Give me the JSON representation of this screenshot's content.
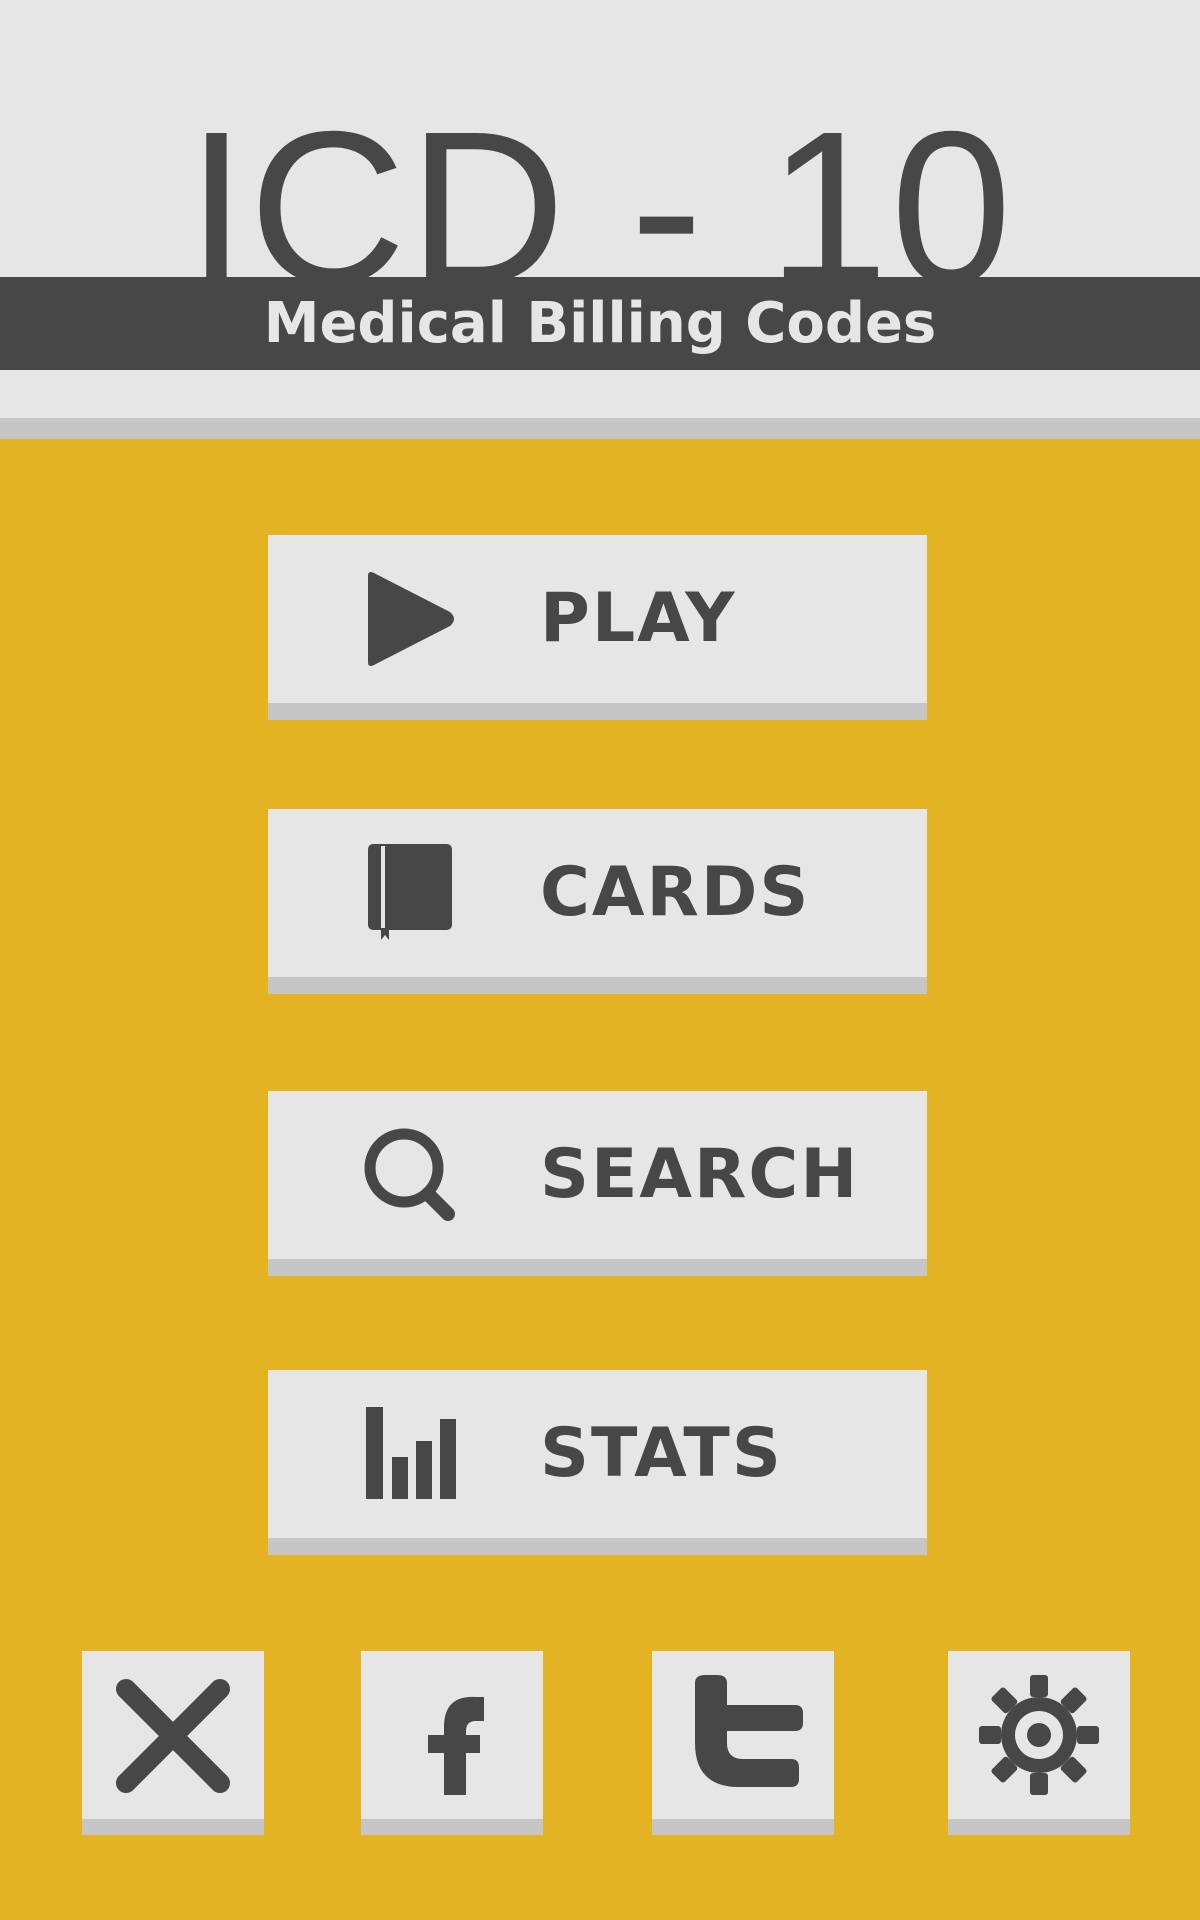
{
  "header": {
    "title": "ICD - 10",
    "subtitle": "Medical Billing Codes"
  },
  "menu": [
    {
      "label": "PLAY",
      "icon": "play-icon"
    },
    {
      "label": "CARDS",
      "icon": "book-icon"
    },
    {
      "label": "SEARCH",
      "icon": "magnifier-icon"
    },
    {
      "label": "STATS",
      "icon": "bar-chart-icon"
    }
  ],
  "bottom_bar": [
    {
      "icon": "close-icon"
    },
    {
      "icon": "facebook-icon"
    },
    {
      "icon": "twitter-icon"
    },
    {
      "icon": "gear-icon"
    }
  ],
  "colors": {
    "background": "#e4b323",
    "header_background": "#e6e6e6",
    "dark": "#474747",
    "button_face": "#e6e6e6",
    "button_shadow": "#c6c6c6"
  }
}
